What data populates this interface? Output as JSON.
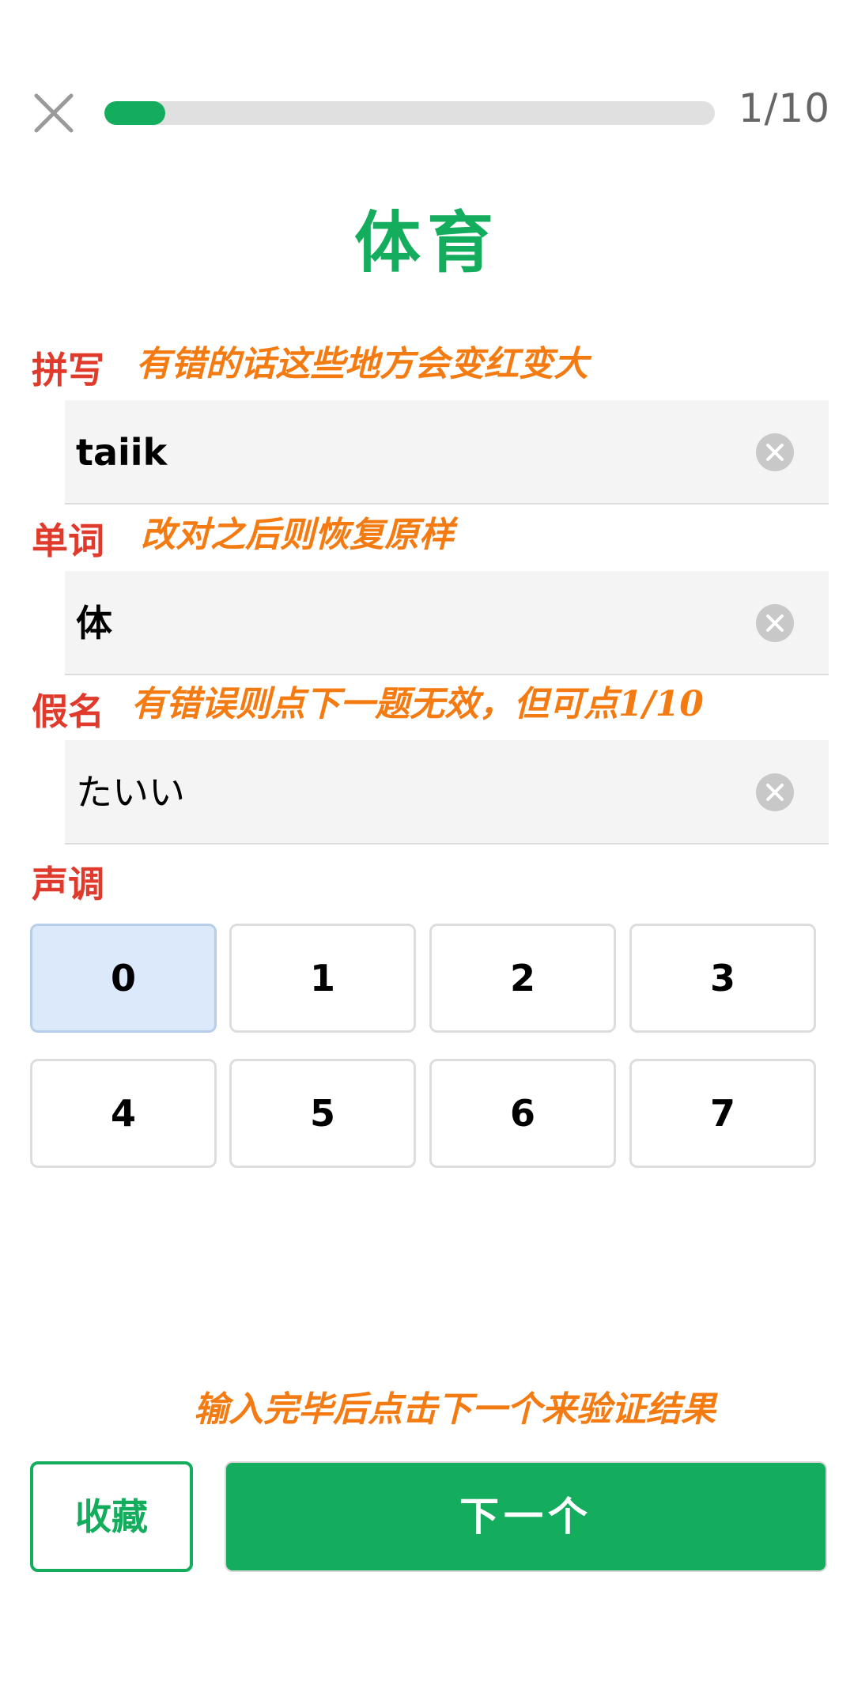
{
  "colors": {
    "accent_green": "#14ad5e",
    "label_red": "#e03a2c",
    "hint_orange": "#f47a12",
    "progress_track": "#e0e0e0",
    "selected_tone_bg": "#dbe9fb"
  },
  "header": {
    "close_icon": "close-icon",
    "progress_fraction": 0.1,
    "progress_text": "1/10"
  },
  "title": "体育",
  "fields": {
    "spelling": {
      "label": "拼写",
      "hint": "有错的话这些地方会变红变大",
      "value": "taiik",
      "clear_icon": "clear-icon"
    },
    "word": {
      "label": "单词",
      "hint": "改对之后则恢复原样",
      "value": "体",
      "clear_icon": "clear-icon"
    },
    "kana": {
      "label": "假名",
      "hint": "有错误则点下一题无效，但可点1/10",
      "value": "たいい",
      "clear_icon": "clear-icon"
    }
  },
  "tone": {
    "label": "声调",
    "options": [
      "0",
      "1",
      "2",
      "3",
      "4",
      "5",
      "6",
      "7"
    ],
    "selected": "0"
  },
  "bottom_hint": "输入完毕后点击下一个来验证结果",
  "buttons": {
    "favorite": "收藏",
    "next": "下一个"
  }
}
